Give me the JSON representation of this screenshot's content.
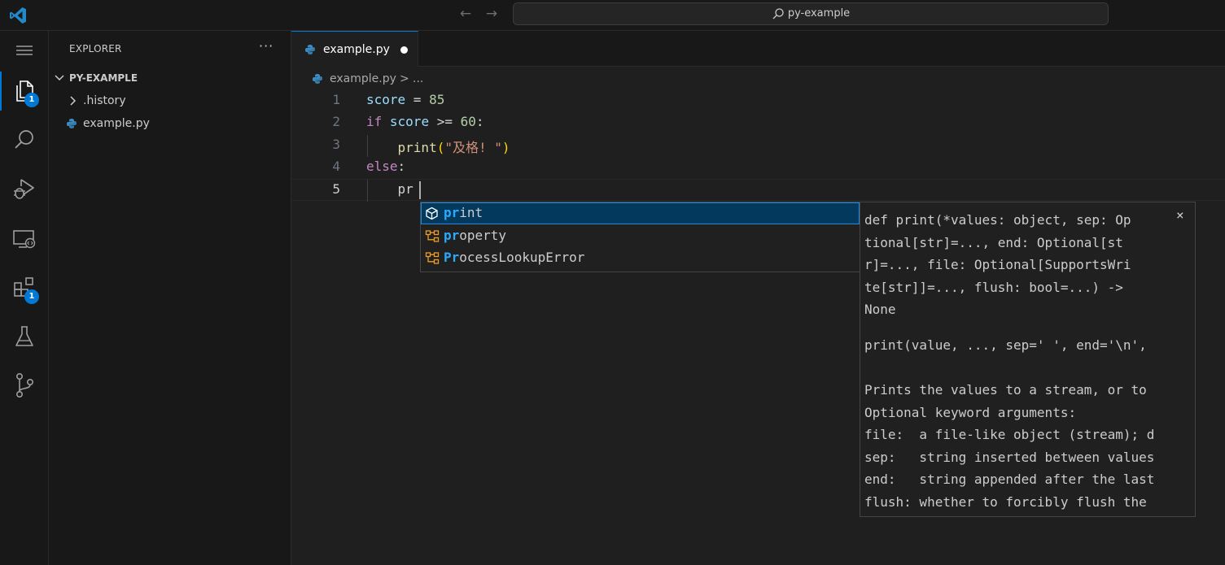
{
  "titlebar": {
    "search_text": "py-example",
    "back_icon": "arrow-left-icon",
    "forward_icon": "arrow-right-icon"
  },
  "activity_bar": {
    "items": [
      {
        "name": "explorer",
        "icon": "files-icon",
        "badge": "1",
        "active": true
      },
      {
        "name": "search",
        "icon": "search-icon"
      },
      {
        "name": "run-debug",
        "icon": "run-debug-icon"
      },
      {
        "name": "remote-explorer",
        "icon": "remote-explorer-icon"
      },
      {
        "name": "extensions",
        "icon": "extensions-icon",
        "badge": "1"
      },
      {
        "name": "testing",
        "icon": "flask-icon"
      },
      {
        "name": "source-control",
        "icon": "source-control-icon"
      }
    ]
  },
  "sidebar": {
    "title": "EXPLORER",
    "more": "···",
    "folder": "PY-EXAMPLE",
    "items": [
      {
        "label": ".history",
        "type": "folder"
      },
      {
        "label": "example.py",
        "type": "python-file"
      }
    ]
  },
  "editor": {
    "tab_label": "example.py",
    "breadcrumb": {
      "file": "example.py",
      "separator": ">",
      "more": "..."
    },
    "line_numbers": [
      "1",
      "2",
      "3",
      "4",
      "5"
    ],
    "lines": [
      "score = 85",
      "if score >= 60:",
      "    print(\"及格! \")",
      "else:",
      "    pr"
    ],
    "tokens": {
      "l1": {
        "var": "score",
        "op": " = ",
        "num": "85"
      },
      "l2": {
        "kw": "if",
        "sp": " ",
        "var": "score",
        "op": " >= ",
        "num": "60",
        "colon": ":"
      },
      "l3": {
        "indent": "    ",
        "fn": "print",
        "open": "(",
        "str": "\"及格! \"",
        "close": ")"
      },
      "l4": {
        "kw": "else",
        "colon": ":"
      },
      "l5": {
        "indent": "    ",
        "typed": "pr"
      }
    }
  },
  "suggest": {
    "items": [
      {
        "match": "pr",
        "rest": "int",
        "kind": "function-icon",
        "label": "print"
      },
      {
        "match": "pr",
        "rest": "operty",
        "kind": "class-icon",
        "label": "property"
      },
      {
        "match": "Pr",
        "rest": "ocessLookupError",
        "kind": "class-icon",
        "label": "ProcessLookupError"
      }
    ]
  },
  "details": {
    "signature": "def print(*values: object, sep: Op\ntional[str]=..., end: Optional[st\nr]=..., file: Optional[SupportsWri\nte[str]]=..., flush: bool=...) ->\nNone",
    "doc": "print(value, ..., sep=' ', end='\\n',\n\nPrints the values to a stream, or to\nOptional keyword arguments:\nfile:  a file-like object (stream); d\nsep:   string inserted between values\nend:   string appended after the last\nflush: whether to forcibly flush the",
    "close": "×"
  },
  "colors": {
    "accent": "#0078d4",
    "keyword": "#c586c0",
    "number": "#b5cea8",
    "function": "#dcdcaa",
    "string": "#ce9178",
    "variable": "#9cdcfe",
    "match_highlight": "#2aaaff"
  }
}
